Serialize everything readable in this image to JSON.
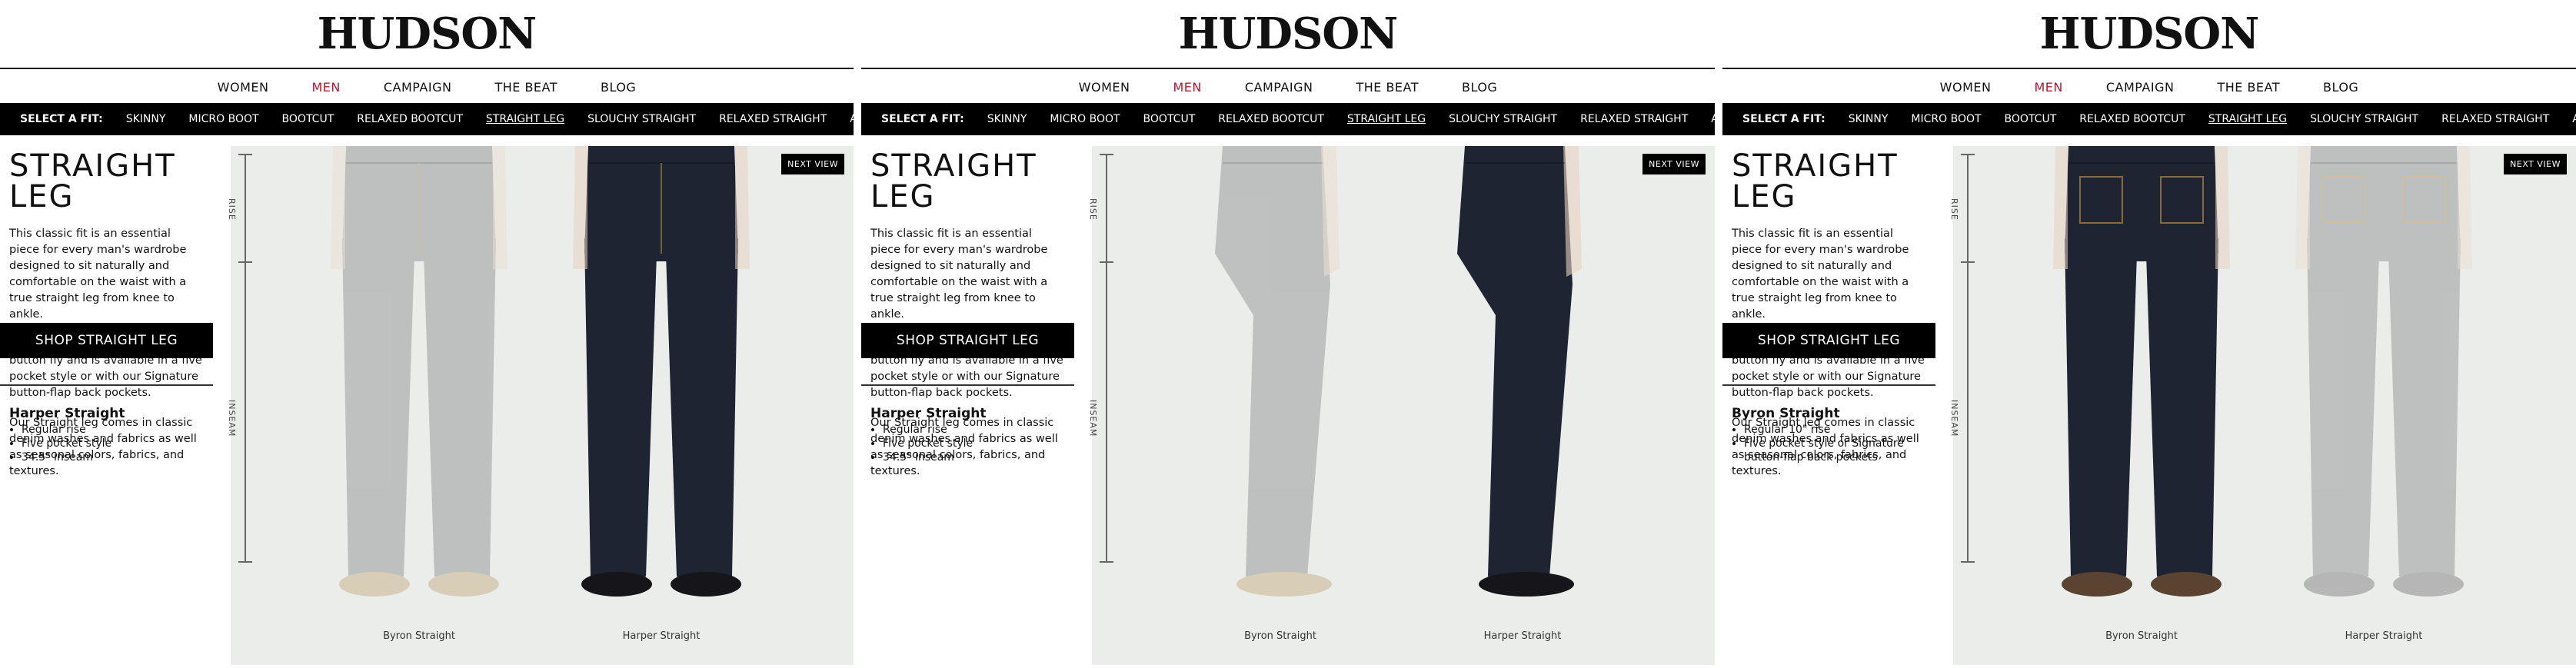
{
  "brand": "HUDSON",
  "main_nav": [
    "WOMEN",
    "MEN",
    "CAMPAIGN",
    "THE BEAT",
    "BLOG"
  ],
  "main_nav_active": "MEN",
  "fit_label": "SELECT A FIT:",
  "fits": [
    "SKINNY",
    "MICRO BOOT",
    "BOOTCUT",
    "RELAXED BOOTCUT",
    "STRAIGHT LEG",
    "SLOUCHY STRAIGHT",
    "RELAXED STRAIGHT",
    "ATHLETIC"
  ],
  "fit_selected": "STRAIGHT LEG",
  "product": {
    "title": "STRAIGHT LEG",
    "paragraphs": [
      "This classic fit is an essential piece for every man's wardrobe designed to sit naturally and comfortable on the waist with a true straight leg from knee to ankle.",
      "This style features a 34\" inseam, button fly and is available in a five pocket style or with our Signature button-flap back pockets.",
      "Our Straight leg comes in classic denim washes and fabrics as well as seasonal colors, fabrics, and textures."
    ],
    "shop_button": "SHOP STRAIGHT LEG"
  },
  "next_view": "NEXT VIEW",
  "measure_labels": {
    "rise": "RISE",
    "inseam": "INSEAM"
  },
  "colors": {
    "accent": "#c8102e",
    "bar": "#000000",
    "stage": "#ebedea",
    "dark_denim": "#1f2433",
    "light_denim": "#9a9a9c"
  },
  "panels": [
    {
      "view": "front",
      "spec_title": "Harper Straight",
      "spec_items": [
        "Regular rise",
        "Five pocket style",
        "34.5\" inseam"
      ],
      "captions": [
        "Byron Straight",
        "Harper Straight"
      ]
    },
    {
      "view": "side",
      "spec_title": "Harper Straight",
      "spec_items": [
        "Regular rise",
        "Five pocket style",
        "34.5\" inseam"
      ],
      "captions": [
        "Byron Straight",
        "Harper Straight"
      ]
    },
    {
      "view": "back",
      "spec_title": "Byron Straight",
      "spec_items": [
        "Regular 10\" rise",
        "Five pocket style or Signature button-flap back pockets"
      ],
      "captions": [
        "Byron Straight",
        "Harper Straight"
      ]
    }
  ]
}
